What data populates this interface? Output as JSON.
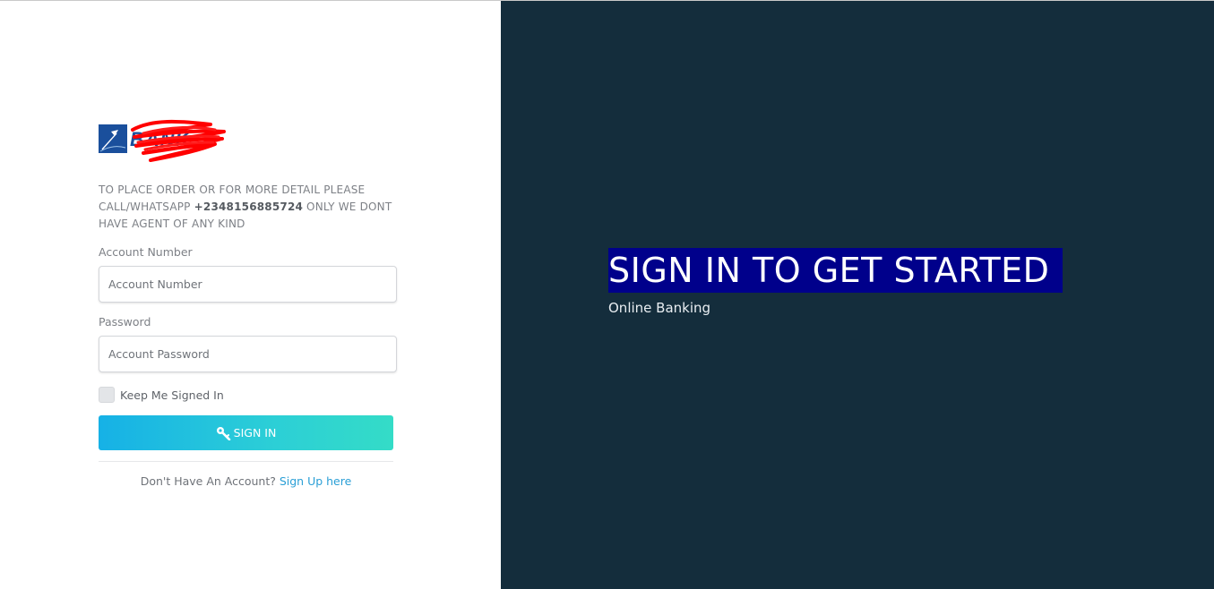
{
  "notice": {
    "text_before": "TO PLACE ORDER OR FOR MORE DETAIL PLEASE CALL/WHATSAPP ",
    "phone": "+2348156885724",
    "text_after": " ONLY WE DONT HAVE AGENT OF ANY KIND"
  },
  "form": {
    "account_label": "Account Number",
    "account_placeholder": "Account Number",
    "password_label": "Password",
    "password_placeholder": "Account Password",
    "keep_signed_in_label": "Keep Me Signed In",
    "signin_label": "SIGN IN",
    "no_account_text": "Don't Have An Account? ",
    "signup_link": "Sign Up here"
  },
  "hero": {
    "title": "SIGN IN TO GET STARTED",
    "subtitle": "Online Banking"
  },
  "colors": {
    "panel_dark": "#142d3c",
    "highlight": "#00008b",
    "button_start": "#16b1e6",
    "button_end": "#34dcc7",
    "link": "#2a9fd6",
    "logo_blue": "#1a4f9c",
    "scribble_red": "#ff0000"
  },
  "icons": {
    "signin": "key-icon",
    "logo": "bank-logo-icon"
  }
}
